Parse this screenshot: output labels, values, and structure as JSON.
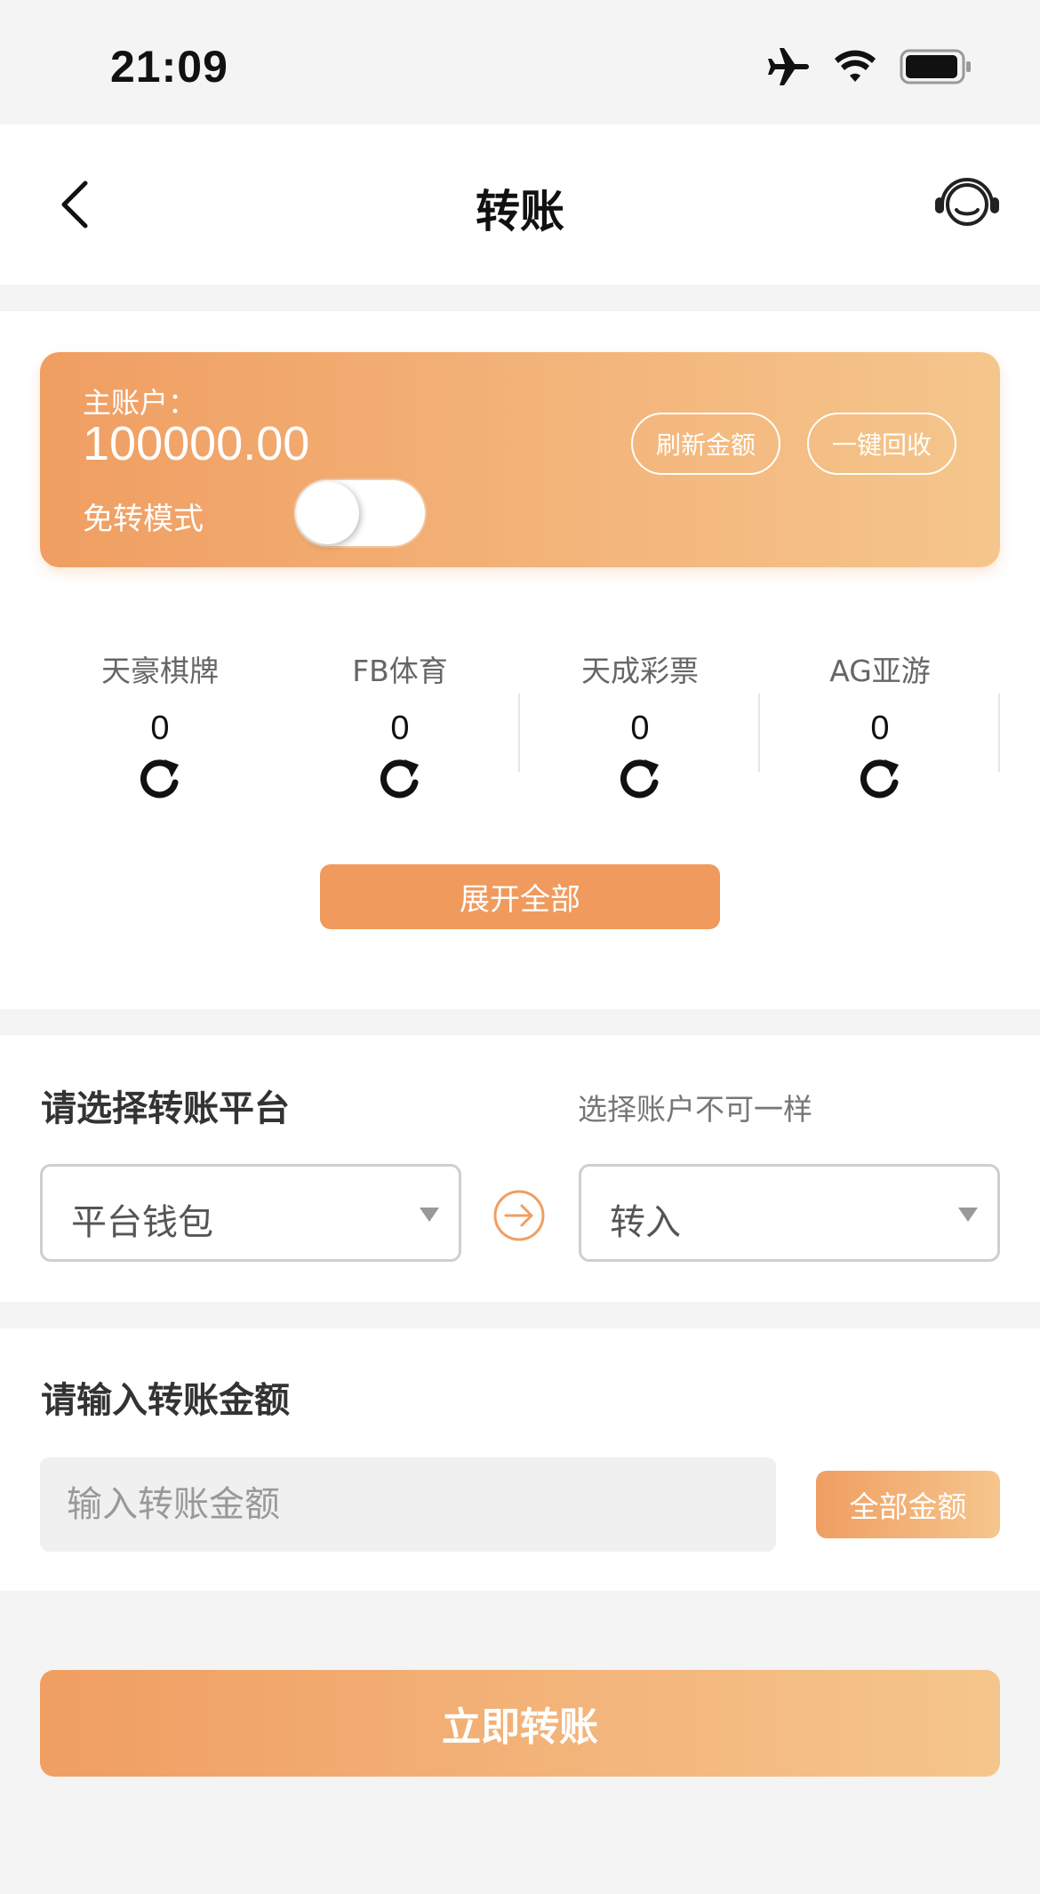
{
  "status_bar": {
    "time": "21:09",
    "icons": [
      "airplane-icon",
      "wifi-icon",
      "battery-icon"
    ]
  },
  "nav": {
    "title": "转账",
    "back_icon": "chevron-left-icon",
    "support_icon": "headset-icon"
  },
  "account": {
    "label": "主账户：",
    "balance": "100000.00",
    "mode_label": "免转模式",
    "mode_enabled": false,
    "refresh_label": "刷新金额",
    "recover_label": "一键回收"
  },
  "platforms": [
    {
      "name": "天豪棋牌",
      "value": "0"
    },
    {
      "name": "FB体育",
      "value": "0"
    },
    {
      "name": "天成彩票",
      "value": "0"
    },
    {
      "name": "AG亚游",
      "value": "0"
    }
  ],
  "expand_label": "展开全部",
  "transfer": {
    "title": "请选择转账平台",
    "hint": "选择账户不可一样",
    "from_value": "平台钱包",
    "to_value": "转入"
  },
  "amount": {
    "title": "请输入转账金额",
    "placeholder": "输入转账金额",
    "all_label": "全部金额"
  },
  "submit_label": "立即转账",
  "colors": {
    "accent": "#f09e62",
    "accent_light": "#f5c68c",
    "page_bg": "#f4f4f4"
  }
}
